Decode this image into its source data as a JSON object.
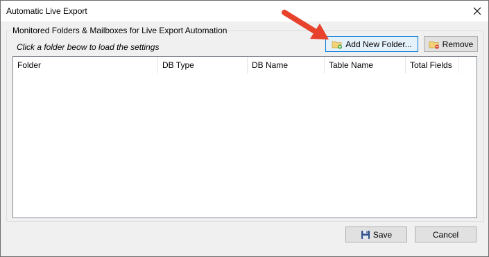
{
  "window": {
    "title": "Automatic Live Export",
    "close_label": "×"
  },
  "group": {
    "title": "Monitored Folders & Mailboxes for Live Export Automation",
    "hint": "Click a folder beow to load the settings"
  },
  "toolbar": {
    "add_label": "Add New Folder...",
    "remove_label": "Remove"
  },
  "table": {
    "columns": [
      "Folder",
      "DB Type",
      "DB Name",
      "Table Name",
      "Total Fields"
    ],
    "rows": []
  },
  "footer": {
    "save_label": "Save",
    "cancel_label": "Cancel"
  },
  "icons": {
    "close": "close-icon",
    "add": "folder-add-icon",
    "remove": "folder-remove-icon",
    "save": "floppy-disk-icon",
    "annotation": "red-arrow-icon"
  },
  "colors": {
    "accent_border": "#0078d7",
    "arrow": "#e8412c"
  }
}
